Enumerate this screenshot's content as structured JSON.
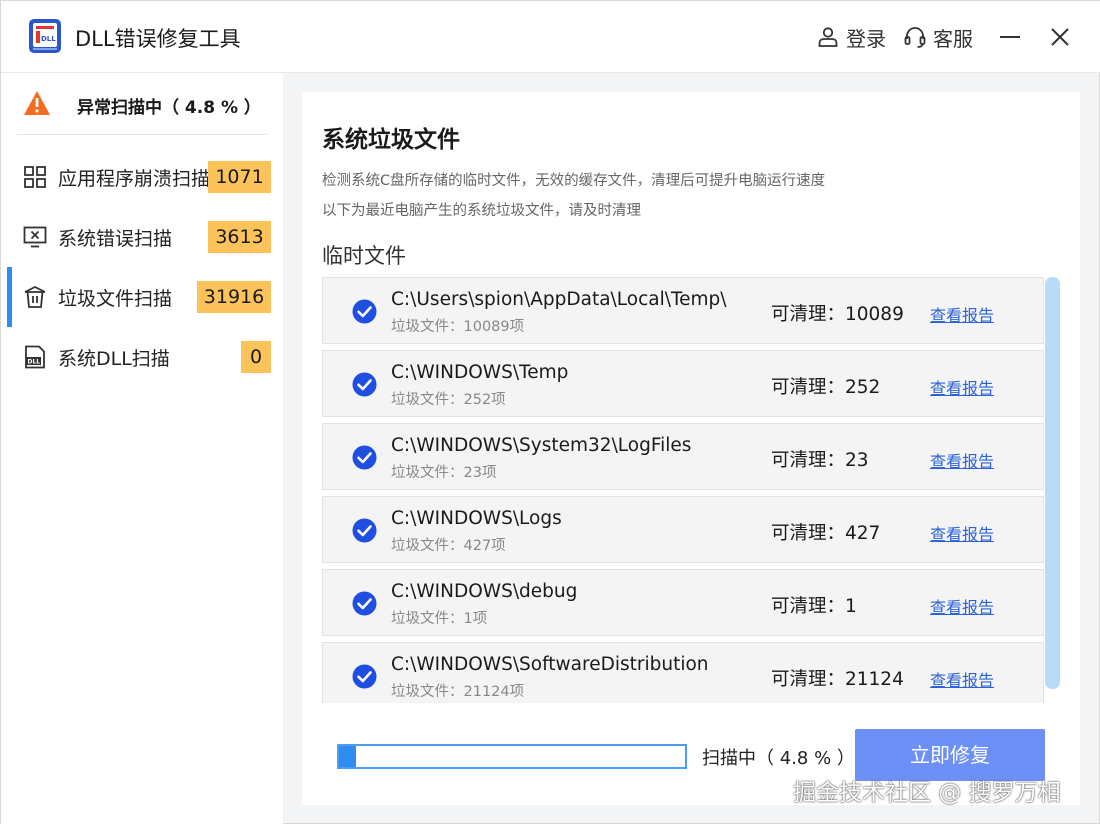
{
  "app": {
    "title": "DLL错误修复工具",
    "login_label": "登录",
    "service_label": "客服"
  },
  "sidebar": {
    "scan_status": "异常扫描中（ 4.8 % ）",
    "items": [
      {
        "label": "应用程序崩溃扫描",
        "count": "1071",
        "icon": "grid-icon",
        "active": false
      },
      {
        "label": "系统错误扫描",
        "count": "3613",
        "icon": "monitor-error-icon",
        "active": false
      },
      {
        "label": "垃圾文件扫描",
        "count": "31916",
        "icon": "trash-icon",
        "active": true
      },
      {
        "label": "系统DLL扫描",
        "count": "0",
        "icon": "dll-file-icon",
        "active": false
      }
    ]
  },
  "main": {
    "title": "系统垃圾文件",
    "desc1": "检测系统C盘所存储的临时文件，无效的缓存文件，清理后可提升电脑运行速度",
    "desc2": "以下为最近电脑产生的系统垃圾文件，请及时清理",
    "section_title": "临时文件",
    "rows": [
      {
        "path": "C:\\Users\\spion\\AppData\\Local\\Temp\\",
        "sub": "垃圾文件：10089项",
        "cleanable": "可清理：10089",
        "report": "查看报告"
      },
      {
        "path": "C:\\WINDOWS\\Temp",
        "sub": "垃圾文件：252项",
        "cleanable": "可清理：252",
        "report": "查看报告"
      },
      {
        "path": "C:\\WINDOWS\\System32\\LogFiles",
        "sub": "垃圾文件：23项",
        "cleanable": "可清理：23",
        "report": "查看报告"
      },
      {
        "path": "C:\\WINDOWS\\Logs",
        "sub": "垃圾文件：427项",
        "cleanable": "可清理：427",
        "report": "查看报告"
      },
      {
        "path": "C:\\WINDOWS\\debug",
        "sub": "垃圾文件：1项",
        "cleanable": "可清理：1",
        "report": "查看报告"
      },
      {
        "path": "C:\\WINDOWS\\SoftwareDistribution",
        "sub": "垃圾文件：21124项",
        "cleanable": "可清理：21124",
        "report": "查看报告"
      }
    ],
    "progress_percent": 4.8,
    "progress_text": "扫描中（ 4.8 % ）",
    "fix_button": "立即修复"
  },
  "watermark": "掘金技术社区 @ 搜罗万相",
  "colors": {
    "accent_blue": "#2f8cf1",
    "badge_yellow": "#fbc35a",
    "warning_orange": "#f36c21",
    "check_blue": "#1e4fe0",
    "link_blue": "#2b63d9",
    "button_blue": "#6d90f6"
  }
}
